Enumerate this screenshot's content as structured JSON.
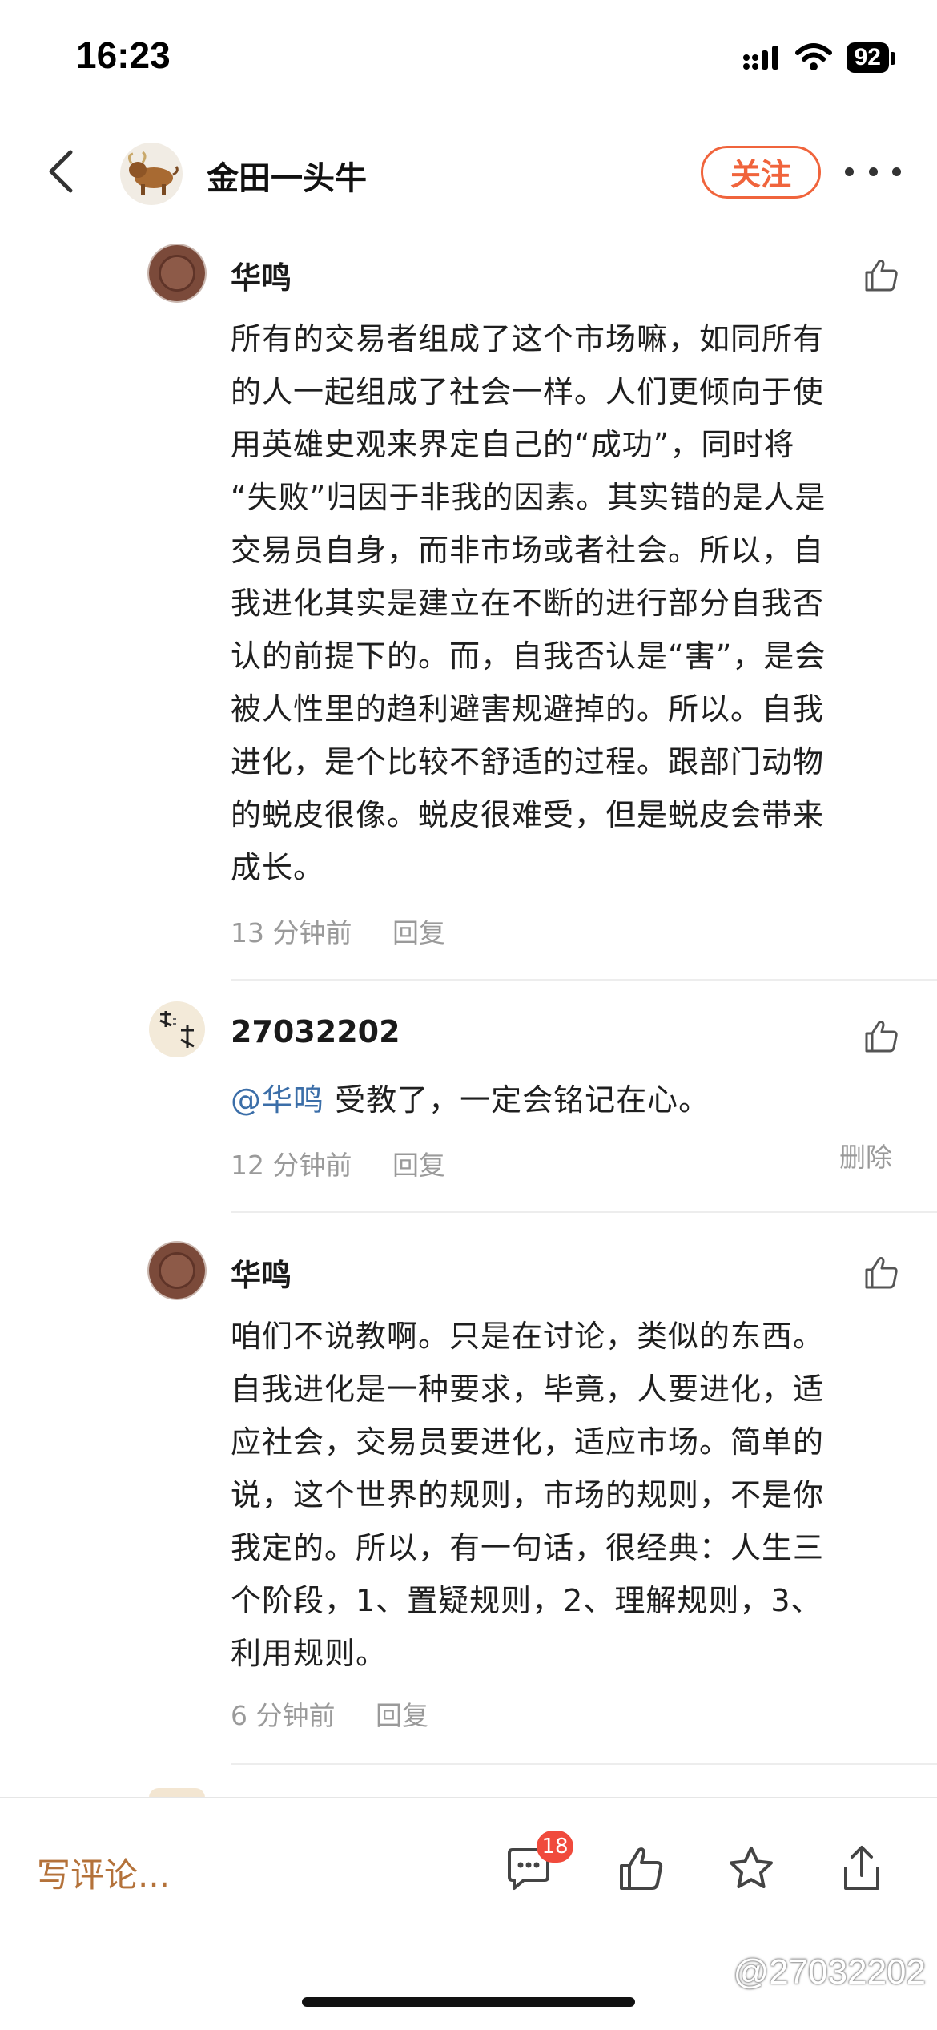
{
  "status_bar": {
    "time": "16:23",
    "battery": "92"
  },
  "nav": {
    "title": "金田一头牛",
    "follow_label": "关注"
  },
  "comments": [
    {
      "author": "华鸣",
      "lines": [
        "所有的交易者组成了这个市场嘛，如同所有",
        "的人一起组成了社会一样。人们更倾向于使",
        "用英雄史观来界定自己的“成功”，同时将",
        "“失败”归因于非我的因素。其实错的是人是",
        "交易员自身，而非市场或者社会。所以，自",
        "我进化其实是建立在不断的进行部分自我否",
        "认的前提下的。而，自我否认是“害”，是会",
        "被人性里的趋利避害规避掉的。所以。自我",
        "进化，是个比较不舒适的过程。跟部门动物",
        "的蜕皮很像。蜕皮很难受，但是蜕皮会带来",
        "成长。"
      ],
      "time": "13 分钟前",
      "reply_label": "回复"
    },
    {
      "author": "27032202",
      "mention": "@华鸣",
      "body": " 受教了，一定会铭记在心。",
      "time": "12 分钟前",
      "reply_label": "回复",
      "delete_label": "删除"
    },
    {
      "author": "华鸣",
      "lines": [
        "咱们不说教啊。只是在讨论，类似的东西。",
        "自我进化是一种要求，毕竟，人要进化，适",
        "应社会，交易员要进化，适应市场。简单的",
        "说，这个世界的规则，市场的规则，不是你",
        "我定的。所以，有一句话，很经典：人生三",
        "个阶段，1、置疑规则，2、理解规则，3、",
        "利用规则。"
      ],
      "time": "6 分钟前",
      "reply_label": "回复"
    }
  ],
  "bottom_bar": {
    "write_placeholder": "写评论...",
    "comment_count": "18",
    "watermark": "@27032202"
  },
  "icons": {
    "back": "back-chevron-icon",
    "more": "more-dots-icon",
    "like": "thumbs-up-icon",
    "comment": "comment-bubble-icon",
    "favorite": "star-icon",
    "share": "share-icon"
  },
  "colors": {
    "accent": "#f0643c",
    "mention": "#3b6ea8",
    "write": "#b4723a",
    "badge": "#f04a3c"
  }
}
